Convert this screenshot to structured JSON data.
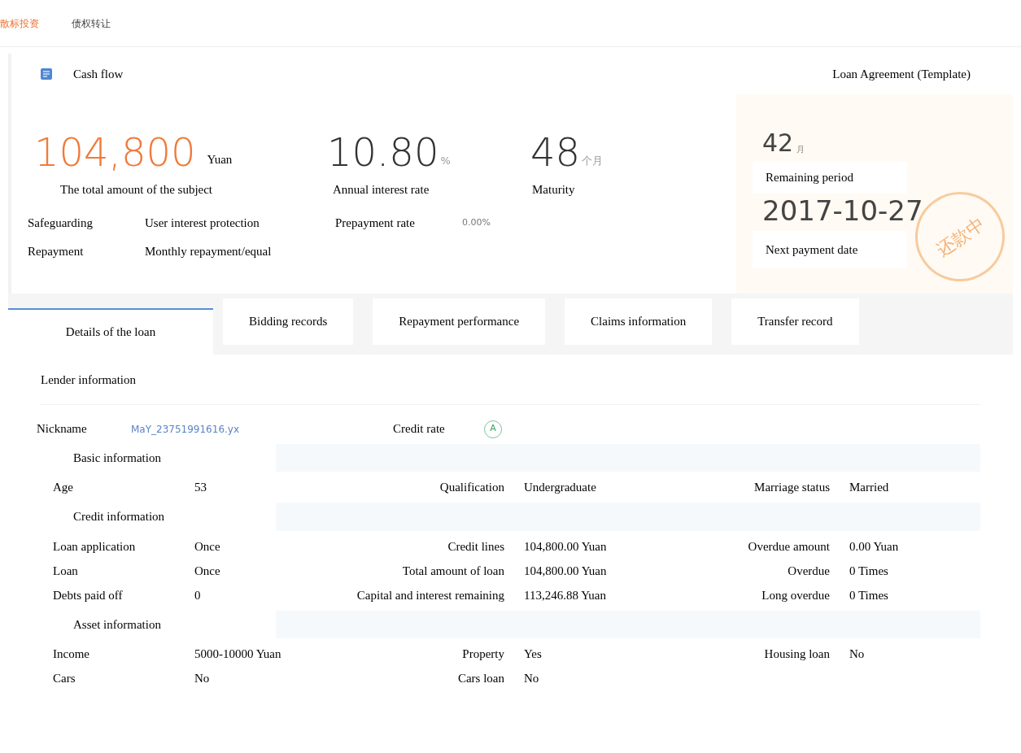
{
  "top_tabs": [
    {
      "label": "散标投资",
      "selected": true
    },
    {
      "label": "债权转让",
      "selected": false
    }
  ],
  "header": {
    "title": "Cash flow",
    "link": "Loan Agreement (Template)"
  },
  "stats": [
    {
      "value": "104,800",
      "unit": "Yuan",
      "label": "The total amount of the subject",
      "kind": "highlight"
    },
    {
      "value": "10.80",
      "unit": "%",
      "label": "Annual interest rate",
      "kind": "normal"
    },
    {
      "value": "48",
      "unit": "个月",
      "label": "Maturity",
      "kind": "normal"
    }
  ],
  "info": [
    {
      "label": "Safeguarding",
      "value": "User interest protection",
      "extra_label": "Prepayment rate",
      "extra_value": "0.00%"
    },
    {
      "label": "Repayment",
      "value": "Monthly repayment/equal"
    }
  ],
  "status": {
    "remaining": "42",
    "remaining_unit": "月",
    "remaining_label": "Remaining period",
    "next_date": "2017-10-27",
    "next_label": "Next payment date",
    "stamp": "还款中"
  },
  "detail_tabs": [
    {
      "label": "Details of the loan",
      "selected": true
    },
    {
      "label": "Bidding records",
      "selected": false
    },
    {
      "label": "Repayment performance",
      "selected": false
    },
    {
      "label": "Claims information",
      "selected": false
    },
    {
      "label": "Transfer record",
      "selected": false
    }
  ],
  "lender": {
    "title": "Lender information",
    "nickname_label": "Nickname",
    "nickname": "MaY_23751991616.yx",
    "credit_label": "Credit rate",
    "credit": "A"
  },
  "sections": [
    {
      "title": "Basic information",
      "rows": [
        [
          {
            "label": "Age",
            "value": "53"
          },
          {
            "label": "Qualification",
            "value": "Undergraduate"
          },
          {
            "label": "Marriage status",
            "value": "Married"
          }
        ]
      ]
    },
    {
      "title": "Credit information",
      "rows": [
        [
          {
            "label": "Loan application",
            "value": "Once"
          },
          {
            "label": "Credit lines",
            "value": "104,800.00 Yuan"
          },
          {
            "label": "Overdue amount",
            "value": "0.00 Yuan"
          }
        ],
        [
          {
            "label": "Loan",
            "value": "Once"
          },
          {
            "label": "Total amount of loan",
            "value": "104,800.00 Yuan"
          },
          {
            "label": "Overdue",
            "value": "0 Times"
          }
        ],
        [
          {
            "label": "Debts paid off",
            "value": "0"
          },
          {
            "label": "Capital and interest remaining",
            "value": "113,246.88 Yuan"
          },
          {
            "label": "Long overdue",
            "value": "0 Times"
          }
        ]
      ]
    },
    {
      "title": "Asset information",
      "rows": [
        [
          {
            "label": "Income",
            "value": "5000-10000 Yuan"
          },
          {
            "label": "Property",
            "value": "Yes"
          },
          {
            "label": "Housing loan",
            "value": "No"
          }
        ],
        [
          {
            "label": "Cars",
            "value": "No"
          },
          {
            "label": "Cars loan",
            "value": "No"
          }
        ]
      ]
    }
  ]
}
